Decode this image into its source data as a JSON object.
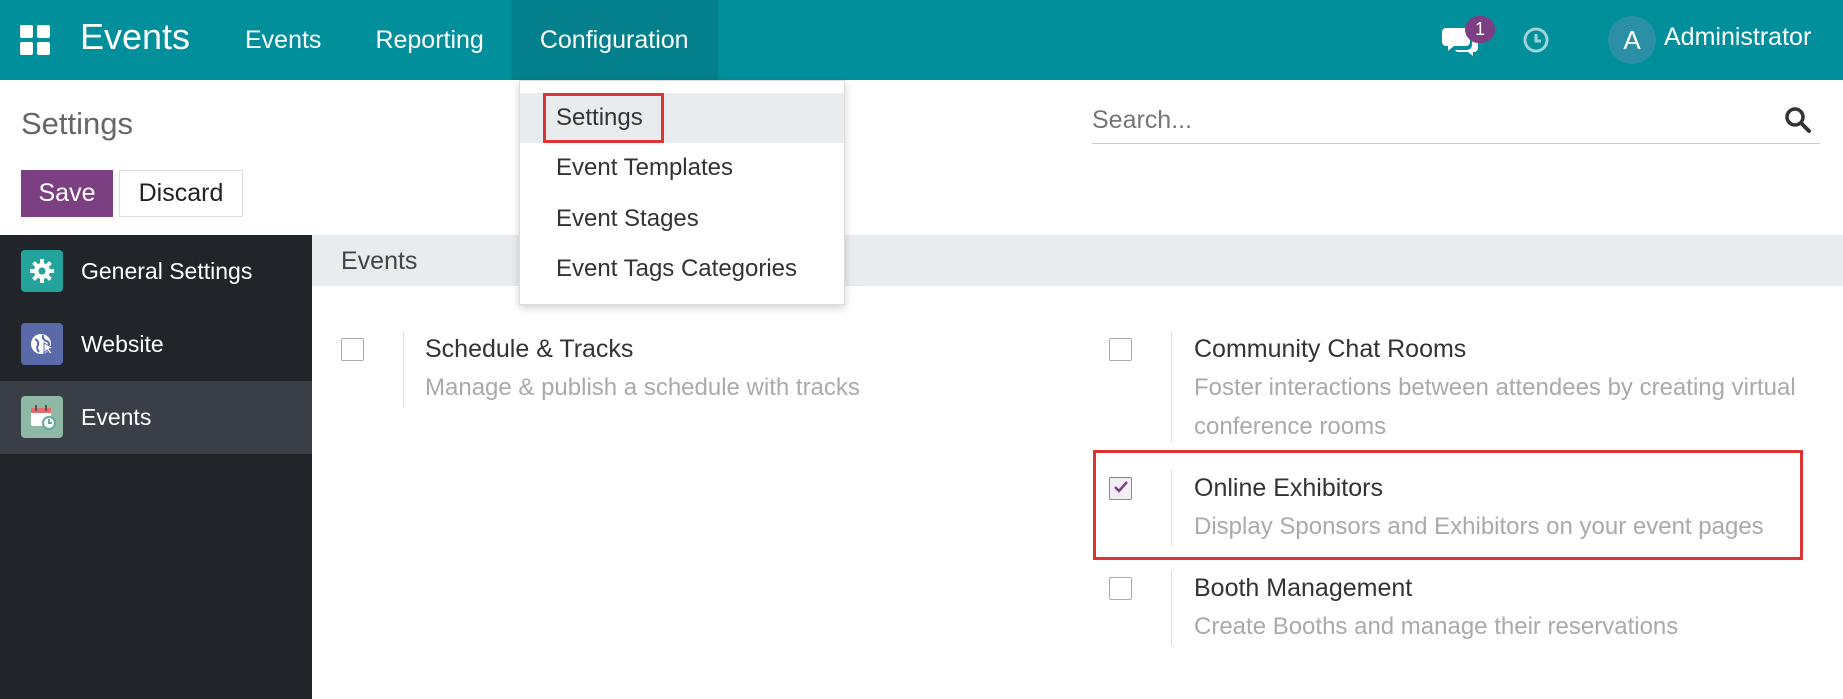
{
  "navbar": {
    "brand": "Events",
    "menu": [
      "Events",
      "Reporting",
      "Configuration"
    ],
    "active_menu": "Configuration",
    "chat_badge": "1",
    "avatar_letter": "A",
    "user_name": "Administrator",
    "accent_color": "#018f9c"
  },
  "dropdown": {
    "items": [
      "Settings",
      "Event Templates",
      "Event Stages",
      "Event Tags Categories"
    ]
  },
  "control_panel": {
    "title": "Settings",
    "save_label": "Save",
    "discard_label": "Discard",
    "search_placeholder": "Search..."
  },
  "sidebar": {
    "items": [
      {
        "label": "General Settings",
        "icon": "gear-icon",
        "color": "#23a39b"
      },
      {
        "label": "Website",
        "icon": "globe-icon",
        "color": "#5a6aa8"
      },
      {
        "label": "Events",
        "icon": "event-calendar-icon",
        "color": "#8fb8a5"
      }
    ],
    "active": "Events"
  },
  "section": {
    "title": "Events",
    "settings": [
      {
        "title": "Schedule & Tracks",
        "description": "Manage & publish a schedule with tracks",
        "checked": false
      },
      {
        "title": "Community Chat Rooms",
        "description": "Foster interactions between attendees by creating virtual conference rooms",
        "checked": false
      },
      {
        "title": "Online Exhibitors",
        "description": "Display Sponsors and Exhibitors on your event pages",
        "checked": true
      },
      {
        "title": "Booth Management",
        "description": "Create Booths and manage their reservations",
        "checked": false
      }
    ]
  },
  "colors": {
    "primary": "#7c3f82",
    "highlight": "#dd3333",
    "sidebar_bg": "#212529"
  }
}
